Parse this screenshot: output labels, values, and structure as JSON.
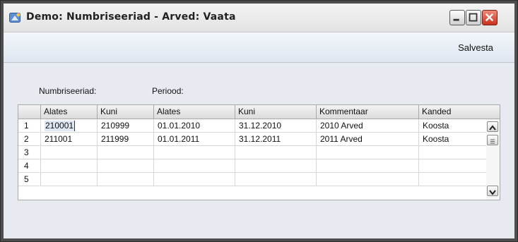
{
  "window": {
    "title": "Demo: Numbriseeriad - Arved: Vaata",
    "icons": {
      "app": "app-icon",
      "minimize": "minimize-icon",
      "maximize": "maximize-icon",
      "close": "close-icon"
    }
  },
  "toolbar": {
    "save_label": "Salvesta"
  },
  "labels": {
    "series": "Numbriseeriad:",
    "period": "Periood:"
  },
  "table": {
    "columns": [
      "Alates",
      "Kuni",
      "Alates",
      "Kuni",
      "Kommentaar",
      "Kanded"
    ],
    "rows": [
      {
        "n": "1",
        "cells": [
          "210001",
          "210999",
          "01.01.2010",
          "31.12.2010",
          "2010 Arved",
          "Koosta"
        ]
      },
      {
        "n": "2",
        "cells": [
          "211001",
          "211999",
          "01.01.2011",
          "31.12.2011",
          "2011 Arved",
          "Koosta"
        ]
      },
      {
        "n": "3",
        "cells": [
          "",
          "",
          "",
          "",
          "",
          ""
        ]
      },
      {
        "n": "4",
        "cells": [
          "",
          "",
          "",
          "",
          "",
          ""
        ]
      },
      {
        "n": "5",
        "cells": [
          "",
          "",
          "",
          "",
          "",
          ""
        ]
      }
    ]
  },
  "scrollbar": {
    "up": "chevron-up-icon",
    "thumb": "scroll-thumb-icon",
    "down": "chevron-down-icon"
  }
}
